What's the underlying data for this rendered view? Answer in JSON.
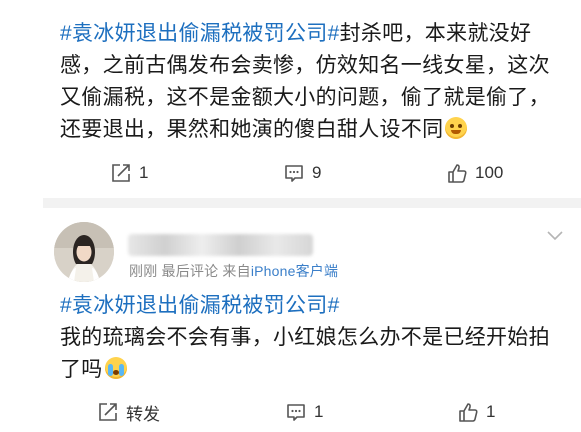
{
  "post1": {
    "topic": "#袁冰妍退出偷漏税被罚公司#",
    "text": "封杀吧，本来就没好感，之前古偶发布会卖惨，仿效知名一线女星，这次又偷漏税，这不是金额大小的问题，偷了就是偷了，还要退出，果然和她演的傻白甜人设不同",
    "emoji": "emoji-hold-laugh-icon",
    "actions": {
      "repost": "1",
      "comment": "9",
      "like": "100"
    }
  },
  "post2": {
    "meta_time": "刚刚",
    "meta_status": "最后评论",
    "meta_from": "来自",
    "meta_source": "iPhone客户端",
    "topic": "#袁冰妍退出偷漏税被罚公司#",
    "text": "我的琉璃会不会有事，小红娘怎么办不是已经开始拍了吗",
    "emoji": "emoji-cry-icon",
    "actions": {
      "repost": "转发",
      "comment": "1",
      "like": "1"
    }
  },
  "colors": {
    "topic": "#1d6fbf",
    "meta": "#8a8a8a",
    "link": "#3b7fc9",
    "divider": "#f2f2f2"
  }
}
